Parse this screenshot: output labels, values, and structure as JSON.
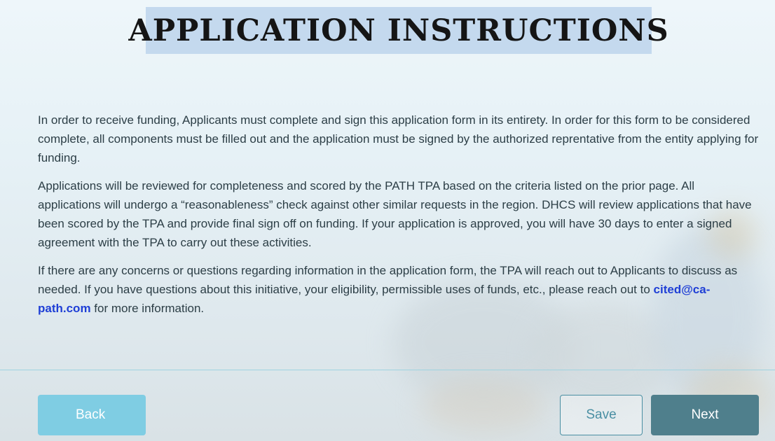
{
  "header": {
    "title": "APPLICATION INSTRUCTIONS"
  },
  "content": {
    "paragraph1": "In order to receive funding, Applicants must complete and sign this application form in its entirety. In order for this form to be considered complete, all components must be filled out and the application must be signed by the authorized reprentative from the entity applying for funding.",
    "paragraph2": "Applications will be reviewed for completeness and scored by the PATH TPA based on the criteria listed on the prior page. All applications will undergo a “reasonableness” check against other similar requests in the region. DHCS will review applications that have been scored by the TPA and provide final sign off on funding. If your application is approved, you will have 30 days to enter a signed agreement with the TPA to carry out these activities.",
    "paragraph3_before": "If there are any concerns or questions regarding information in the application form, the TPA will reach out to Applicants to discuss as needed. If you have questions about this initiative, your eligibility, permissible uses of funds, etc., please reach out to ",
    "email": "cited@ca-path.com",
    "paragraph3_after": " for more information."
  },
  "footer": {
    "back_label": "Back",
    "save_label": "Save",
    "next_label": "Next"
  },
  "colors": {
    "title_highlight": "#c4d9ee",
    "email_link": "#1f3fd6",
    "back_button": "#7fcde3",
    "next_button": "#4f7f8c",
    "save_border": "#4a8fa3",
    "divider": "#9fd3e0"
  }
}
